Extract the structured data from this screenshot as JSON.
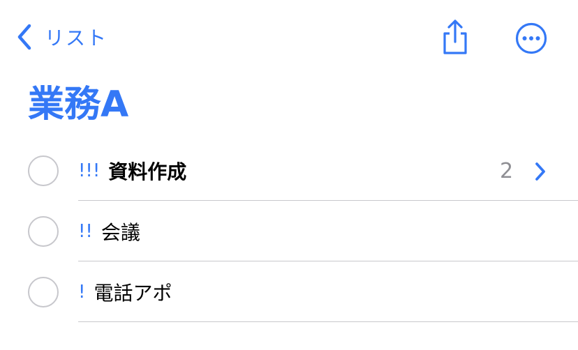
{
  "nav": {
    "back_label": "リスト",
    "back_icon": "chevron-left-icon",
    "share_icon": "share-icon",
    "more_icon": "ellipsis-circle-icon"
  },
  "title": "業務A",
  "tasks": [
    {
      "priority": "!!!",
      "title": "資料作成",
      "bold": true,
      "subtask_count": "2"
    },
    {
      "priority": "!!",
      "title": "会議",
      "bold": false
    },
    {
      "priority": "!",
      "title": "電話アポ",
      "bold": false
    }
  ],
  "colors": {
    "accent": "#3478f6",
    "checkbox_border": "#c7c7cc",
    "secondary_text": "#8e8e93",
    "separator": "#c8c8cc"
  }
}
